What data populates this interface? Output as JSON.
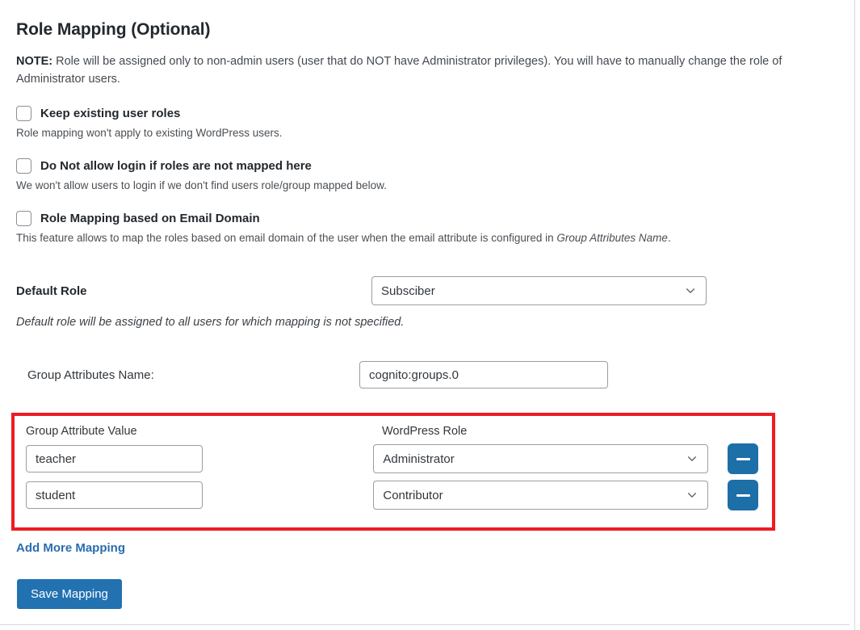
{
  "header": {
    "title": "Role Mapping (Optional)",
    "note_prefix": "NOTE:",
    "note_body": " Role will be assigned only to non-admin users (user that do NOT have Administrator privileges). You will have to manually change the role of Administrator users."
  },
  "options": [
    {
      "label": "Keep existing user roles",
      "description": "Role mapping won't apply to existing WordPress users.",
      "checked": false
    },
    {
      "label": "Do Not allow login if roles are not mapped here",
      "description": "We won't allow users to login if we don't find users role/group mapped below.",
      "checked": false
    },
    {
      "label": "Role Mapping based on Email Domain",
      "description_plain": "This feature allows to map the roles based on email domain of the user when the email attribute is configured in ",
      "description_italic": "Group Attributes Name",
      "description_tail": ".",
      "checked": false
    }
  ],
  "default_role": {
    "label": "Default Role",
    "value": "Subsciber",
    "hint": "Default role will be assigned to all users for which mapping is not specified.",
    "chevron_icon": "chevron-down-icon"
  },
  "group_attributes": {
    "label": "Group Attributes Name:",
    "value": "cognito:groups.0",
    "placeholder": ""
  },
  "mapping": {
    "highlight_color": "#ec1c24",
    "columns": [
      "Group Attribute Value",
      "WordPress Role"
    ],
    "rows": [
      {
        "attribute_value": "teacher",
        "wordpress_role": "Administrator",
        "remove_icon": "minus-icon"
      },
      {
        "attribute_value": "student",
        "wordpress_role": "Contributor",
        "remove_icon": "minus-icon"
      }
    ]
  },
  "actions": {
    "add_more_label": "Add More Mapping",
    "save_label": "Save Mapping",
    "link_color": "#2b6cb0",
    "button_color": "#2271b1"
  }
}
